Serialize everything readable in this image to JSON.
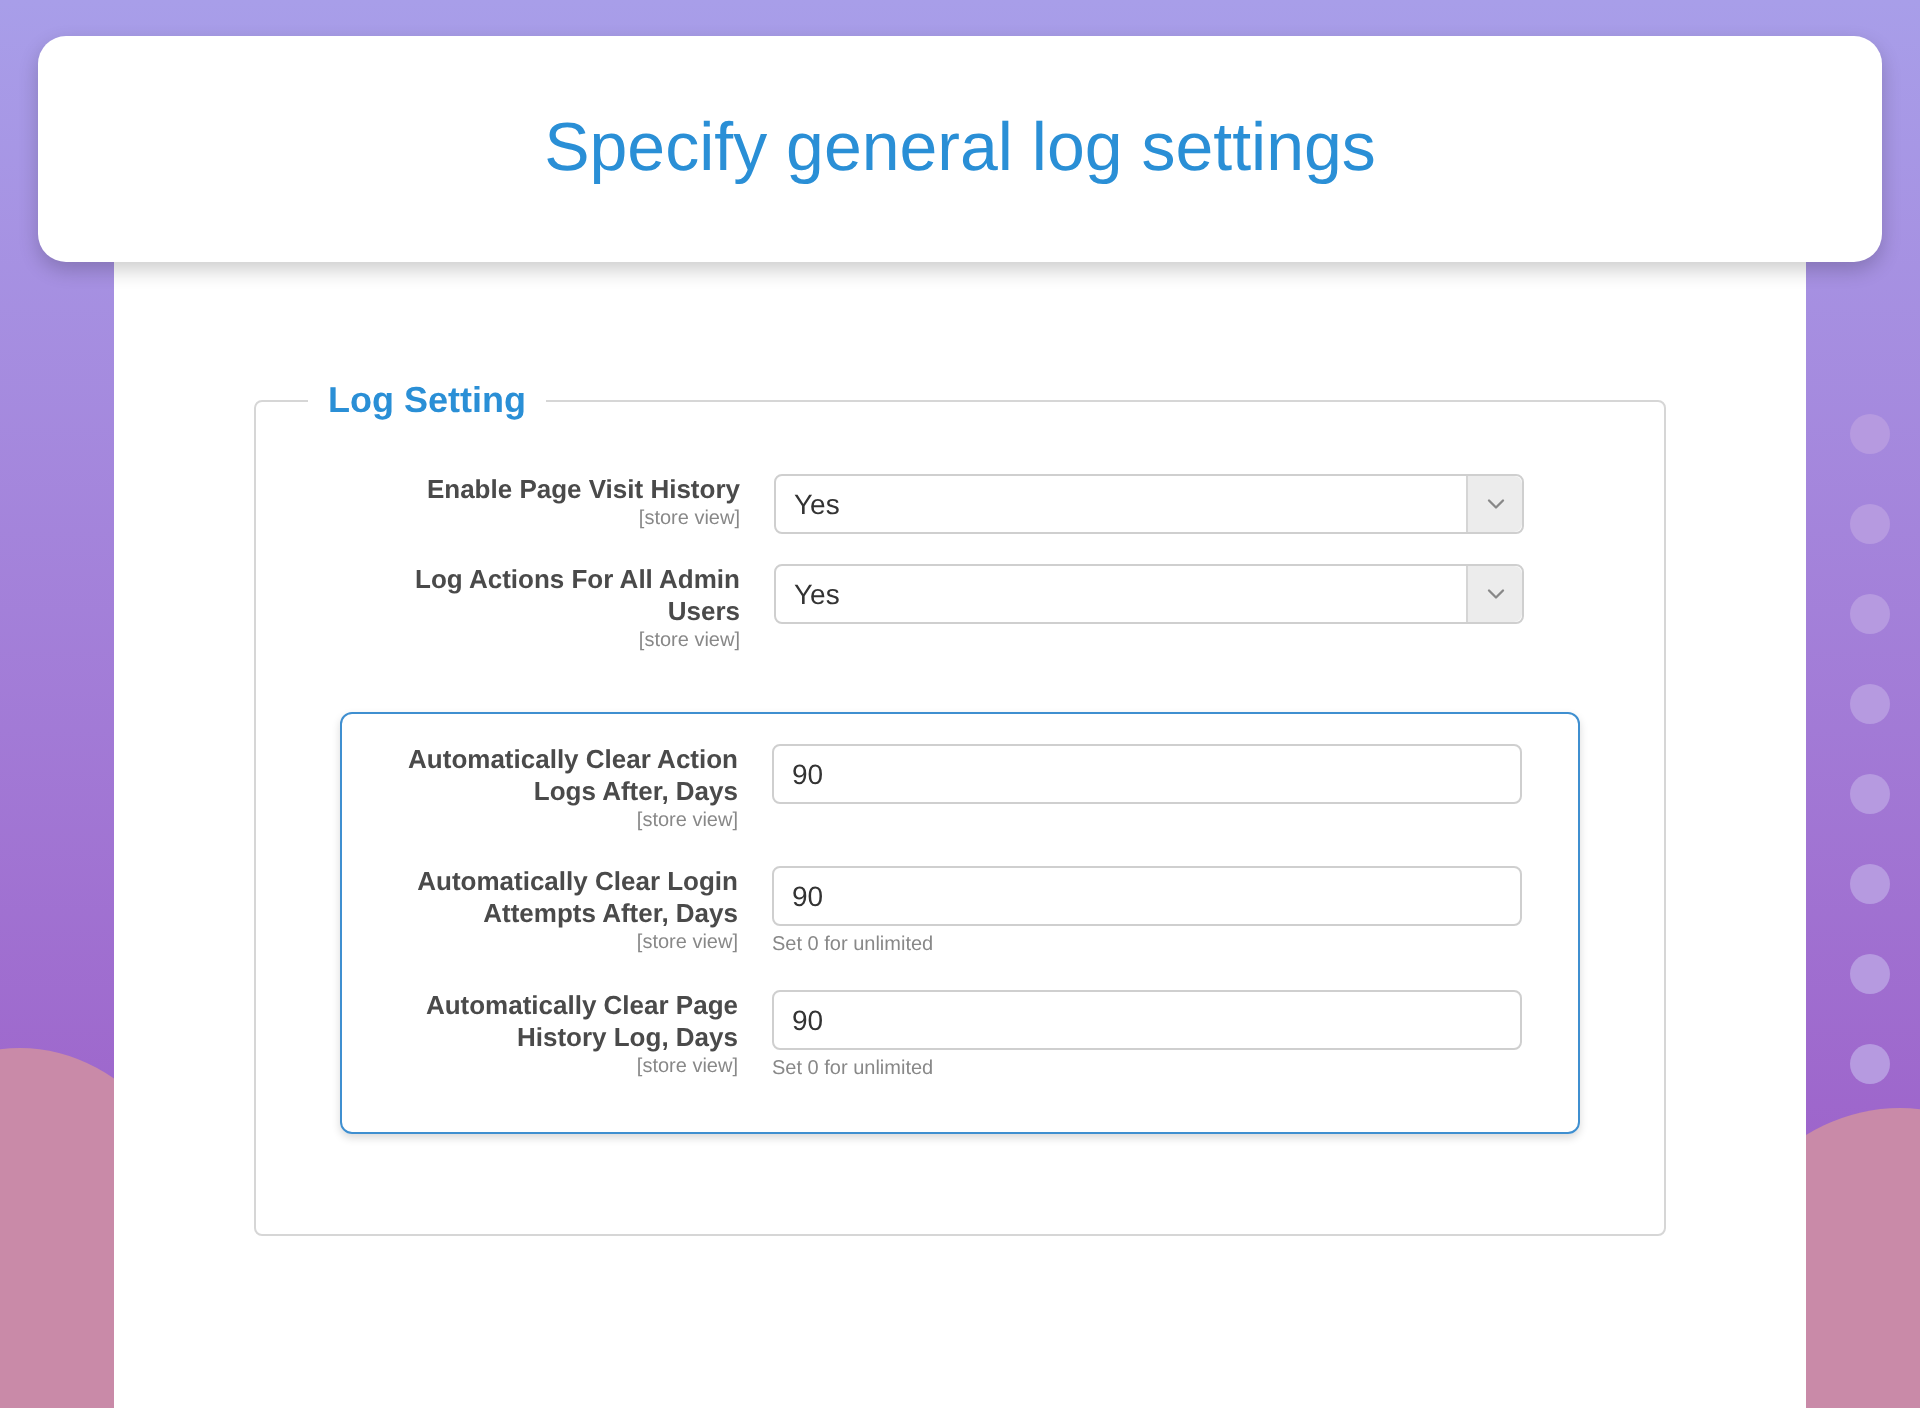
{
  "header": {
    "title": "Specify general log settings"
  },
  "section": {
    "legend": "Log Setting"
  },
  "fields": [
    {
      "kind": "select",
      "label": "Enable Page Visit History",
      "scope": "[store view]",
      "value": "Yes"
    },
    {
      "kind": "select",
      "label": "Log Actions For All Admin Users",
      "scope": "[store view]",
      "value": "Yes"
    }
  ],
  "highlighted_fields": [
    {
      "kind": "number",
      "label": "Automatically Clear Action Logs After, Days",
      "scope": "[store view]",
      "value": "90"
    },
    {
      "kind": "number",
      "label": "Automatically Clear Login Attempts After, Days",
      "scope": "[store view]",
      "value": "90",
      "hint": "Set 0 for unlimited"
    },
    {
      "kind": "number",
      "label": "Automatically Clear Page History Log, Days",
      "scope": "[store view]",
      "value": "90",
      "hint": "Set 0 for unlimited"
    }
  ]
}
